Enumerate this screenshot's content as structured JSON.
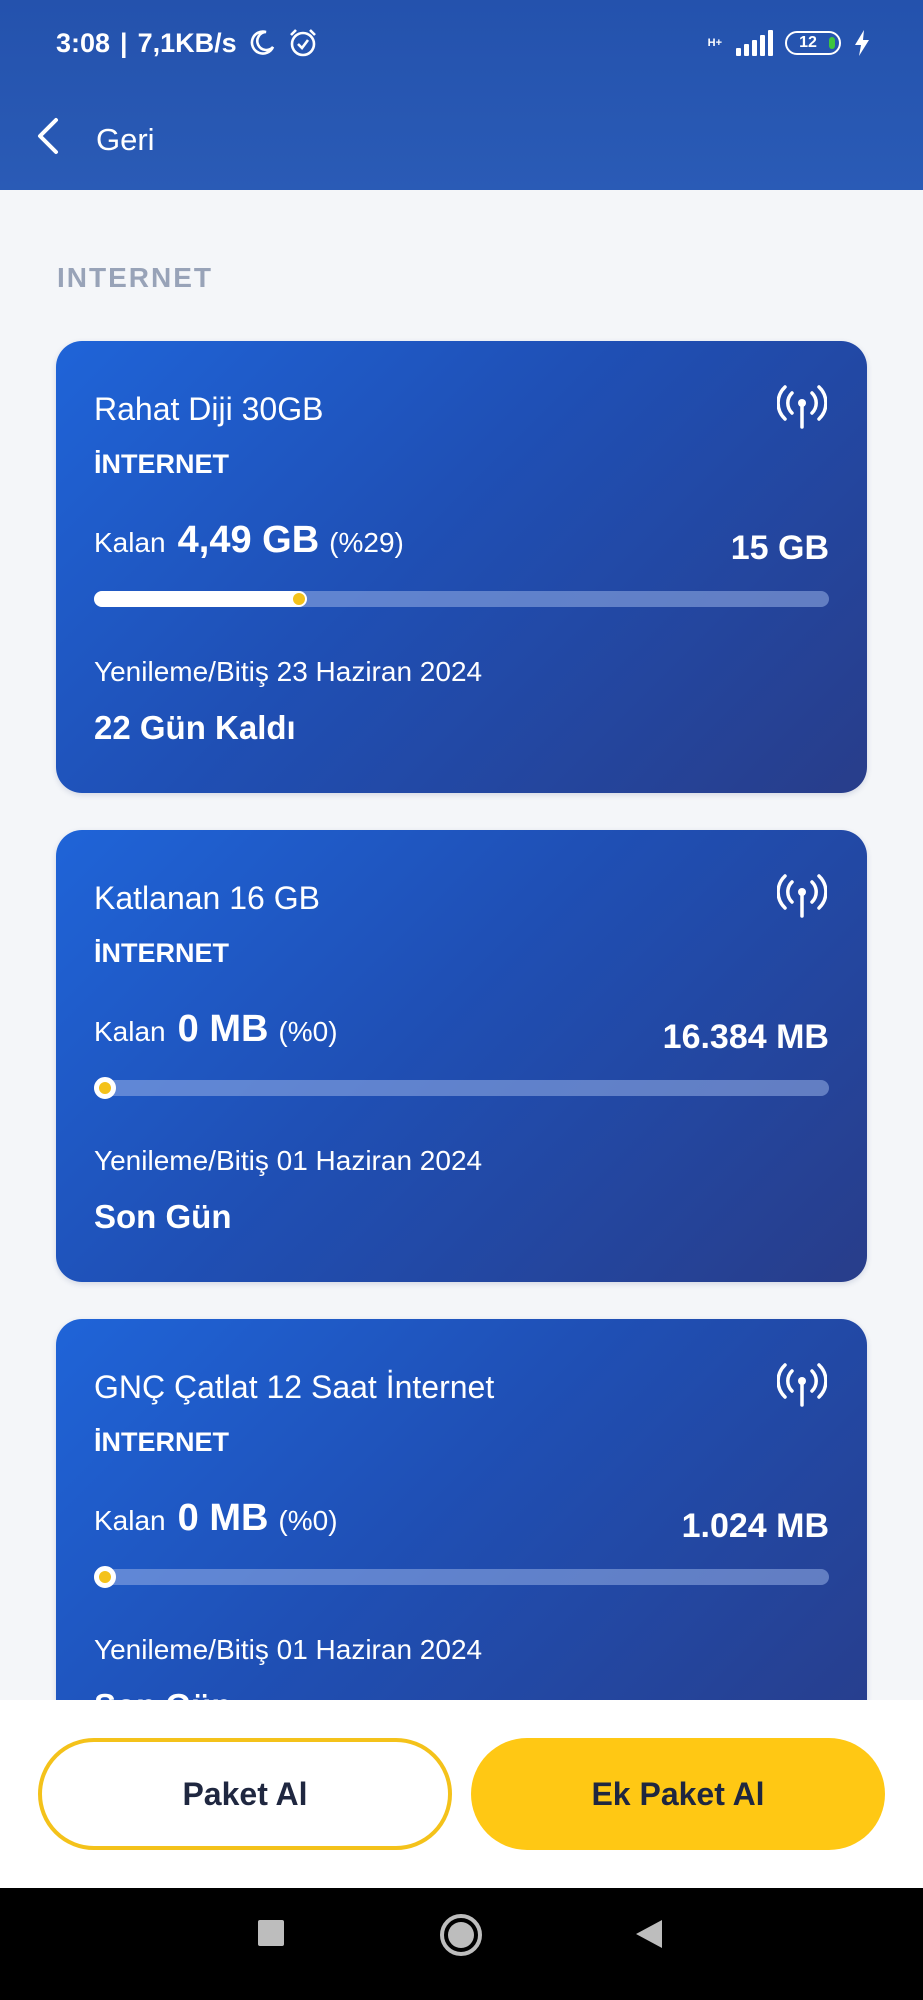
{
  "status_bar": {
    "time": "3:08",
    "separator": "|",
    "speed": "7,1KB/s",
    "network_type": "H+",
    "battery_level": "12",
    "icons": [
      "moon-icon",
      "alarm-icon",
      "signal-icon",
      "battery-icon",
      "charging-bolt-icon"
    ]
  },
  "nav": {
    "back_label": "Geri",
    "back_icon": "chevron-left-icon"
  },
  "section": {
    "title": "INTERNET"
  },
  "packages": [
    {
      "name": "Rahat Diji 30GB",
      "type": "İNTERNET",
      "remaining_label": "Kalan",
      "remaining_value": "4,49 GB",
      "remaining_percent_text": "(%29)",
      "remaining_fraction": 0.29,
      "total": "15 GB",
      "renewal_text": "Yenileme/Bitiş 23 Haziran 2024",
      "days_left": "22 Gün Kaldı",
      "icon": "antenna-icon"
    },
    {
      "name": "Katlanan 16 GB",
      "type": "İNTERNET",
      "remaining_label": "Kalan",
      "remaining_value": "0 MB",
      "remaining_percent_text": "(%0)",
      "remaining_fraction": 0,
      "total": "16.384 MB",
      "renewal_text": "Yenileme/Bitiş 01 Haziran 2024",
      "days_left": "Son Gün",
      "icon": "antenna-icon"
    },
    {
      "name": "GNÇ Çatlat 12 Saat İnternet",
      "type": "İNTERNET",
      "remaining_label": "Kalan",
      "remaining_value": "0 MB",
      "remaining_percent_text": "(%0)",
      "remaining_fraction": 0,
      "total": "1.024 MB",
      "renewal_text": "Yenileme/Bitiş 01 Haziran 2024",
      "days_left": "Son Gün",
      "icon": "antenna-icon"
    }
  ],
  "actions": {
    "buy_package": "Paket Al",
    "buy_addon": "Ek Paket Al"
  },
  "colors": {
    "header": "#2a5bb6",
    "card_start": "#1f64d8",
    "card_end": "#283d8a",
    "accent_yellow": "#ffc814",
    "section_title": "#98a3b8",
    "background": "#f4f6f9"
  },
  "system_nav": {
    "icons": [
      "recent-apps-icon",
      "home-icon",
      "back-triangle-icon"
    ]
  }
}
